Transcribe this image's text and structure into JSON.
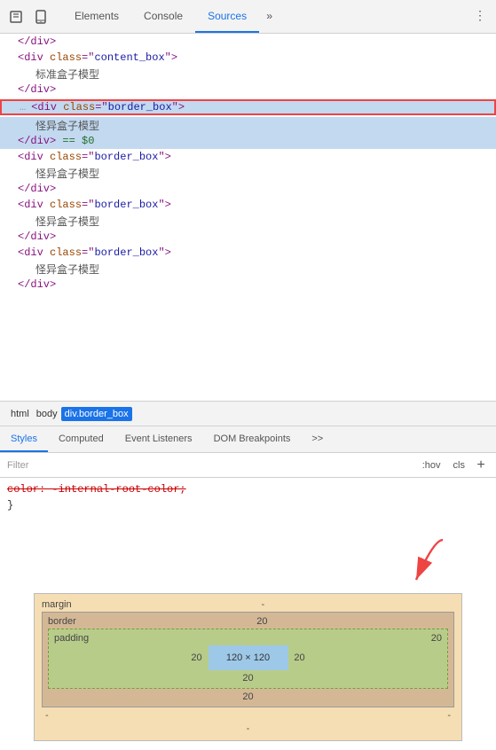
{
  "toolbar": {
    "tabs": [
      "Elements",
      "Console",
      "Sources"
    ],
    "active_tab": "Elements",
    "more_icon": "»",
    "menu_icon": "⋮"
  },
  "elements": {
    "lines": [
      {
        "indent": 1,
        "content": "end_div",
        "raw": "</div>"
      },
      {
        "indent": 1,
        "content": "div_content_box_open",
        "raw": "<div class=\"content_box\">"
      },
      {
        "indent": 2,
        "content": "text_standard",
        "raw": "标准盒子模型"
      },
      {
        "indent": 1,
        "content": "end_div",
        "raw": "</div>"
      },
      {
        "indent": 1,
        "content": "div_border_box_highlighted",
        "raw": "<div class=\"border_box\">"
      },
      {
        "indent": 2,
        "content": "text_weird",
        "raw": "怪异盒子模型"
      },
      {
        "indent": 1,
        "content": "end_div_dollar",
        "raw": "</div> == $0"
      },
      {
        "indent": 1,
        "content": "div_border_box2",
        "raw": "<div class=\"border_box\">"
      },
      {
        "indent": 2,
        "content": "text_weird2",
        "raw": "怪异盒子模型"
      },
      {
        "indent": 1,
        "content": "end_div2",
        "raw": "</div>"
      },
      {
        "indent": 1,
        "content": "div_border_box3",
        "raw": "<div class=\"border_box\">"
      },
      {
        "indent": 2,
        "content": "text_weird3",
        "raw": "怪异盒子模型"
      },
      {
        "indent": 1,
        "content": "end_div3",
        "raw": "</div>"
      },
      {
        "indent": 1,
        "content": "div_border_box4",
        "raw": "<div class=\"border_box\">"
      },
      {
        "indent": 2,
        "content": "text_weird4",
        "raw": "怪异盒子模型"
      },
      {
        "indent": 1,
        "content": "end_div4",
        "raw": "</div>"
      }
    ]
  },
  "breadcrumb": {
    "items": [
      "html",
      "body",
      "div.border_box"
    ]
  },
  "styles_tabs": {
    "items": [
      "Styles",
      "Computed",
      "Event Listeners",
      "DOM Breakpoints"
    ],
    "active": "Styles",
    "more": ">>"
  },
  "filter": {
    "placeholder": "Filter",
    "hov_label": ":hov",
    "cls_label": "cls",
    "plus_label": "+"
  },
  "css": {
    "lines": [
      {
        "content": "color: -internal-root-color;",
        "strikethrough": true
      },
      {
        "content": "}"
      }
    ]
  },
  "box_model": {
    "margin_label": "margin",
    "margin_dash": "-",
    "border_label": "border",
    "border_value": "20",
    "padding_label": "padding",
    "padding_value": "20",
    "content_size": "120 × 120",
    "side_values": {
      "top": "20",
      "right": "20",
      "bottom": "20",
      "left": "20"
    },
    "outer_sides": {
      "left": "-",
      "right": "-"
    },
    "margin_bottom": "-"
  }
}
